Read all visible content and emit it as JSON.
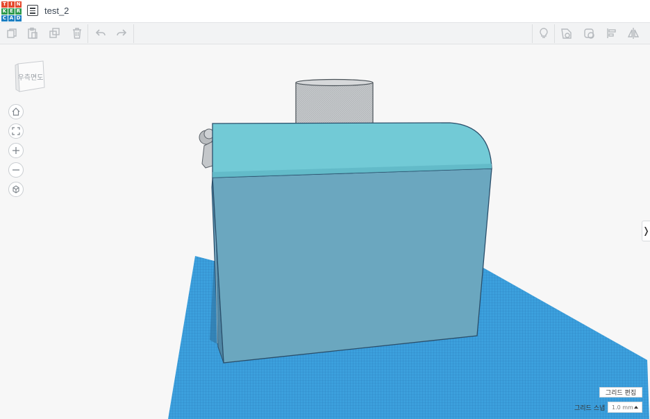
{
  "app": {
    "logo_letters": [
      "T",
      "I",
      "N",
      "K",
      "E",
      "R",
      "C",
      "A",
      "D"
    ],
    "logo_colors": [
      "#e4482c",
      "#e4482c",
      "#e4482c",
      "#2d9a4d",
      "#2d9a4d",
      "#2d9a4d",
      "#1c7fc2",
      "#1c7fc2",
      "#1c7fc2"
    ]
  },
  "header": {
    "title": "test_2",
    "menu_icon": "design-list-icon"
  },
  "toolbar": {
    "left_icons": [
      "copy-icon",
      "paste-icon",
      "duplicate-icon",
      "delete-icon",
      "undo-icon",
      "redo-icon"
    ],
    "right_icons": [
      "light-bulb-icon",
      "shape-solid-icon",
      "shape-hole-icon",
      "align-icon",
      "mirror-icon"
    ]
  },
  "viewcube": {
    "label": "우측면도"
  },
  "nav": {
    "icons": [
      "home-view-icon",
      "fit-view-icon",
      "zoom-in-icon",
      "zoom-out-icon",
      "perspective-icon"
    ]
  },
  "panel_toggle": {
    "label": "❭"
  },
  "grid": {
    "edit_label": "그리드 편집",
    "snap_label": "그리드 스냅",
    "snap_value": "1.0 mm"
  },
  "colors": {
    "workplane": "#3d9edc",
    "box_front": "#6ba7bf",
    "box_top": "#72cad6",
    "cylinder": "#c3c6c9",
    "edge": "#2a4e6a"
  }
}
